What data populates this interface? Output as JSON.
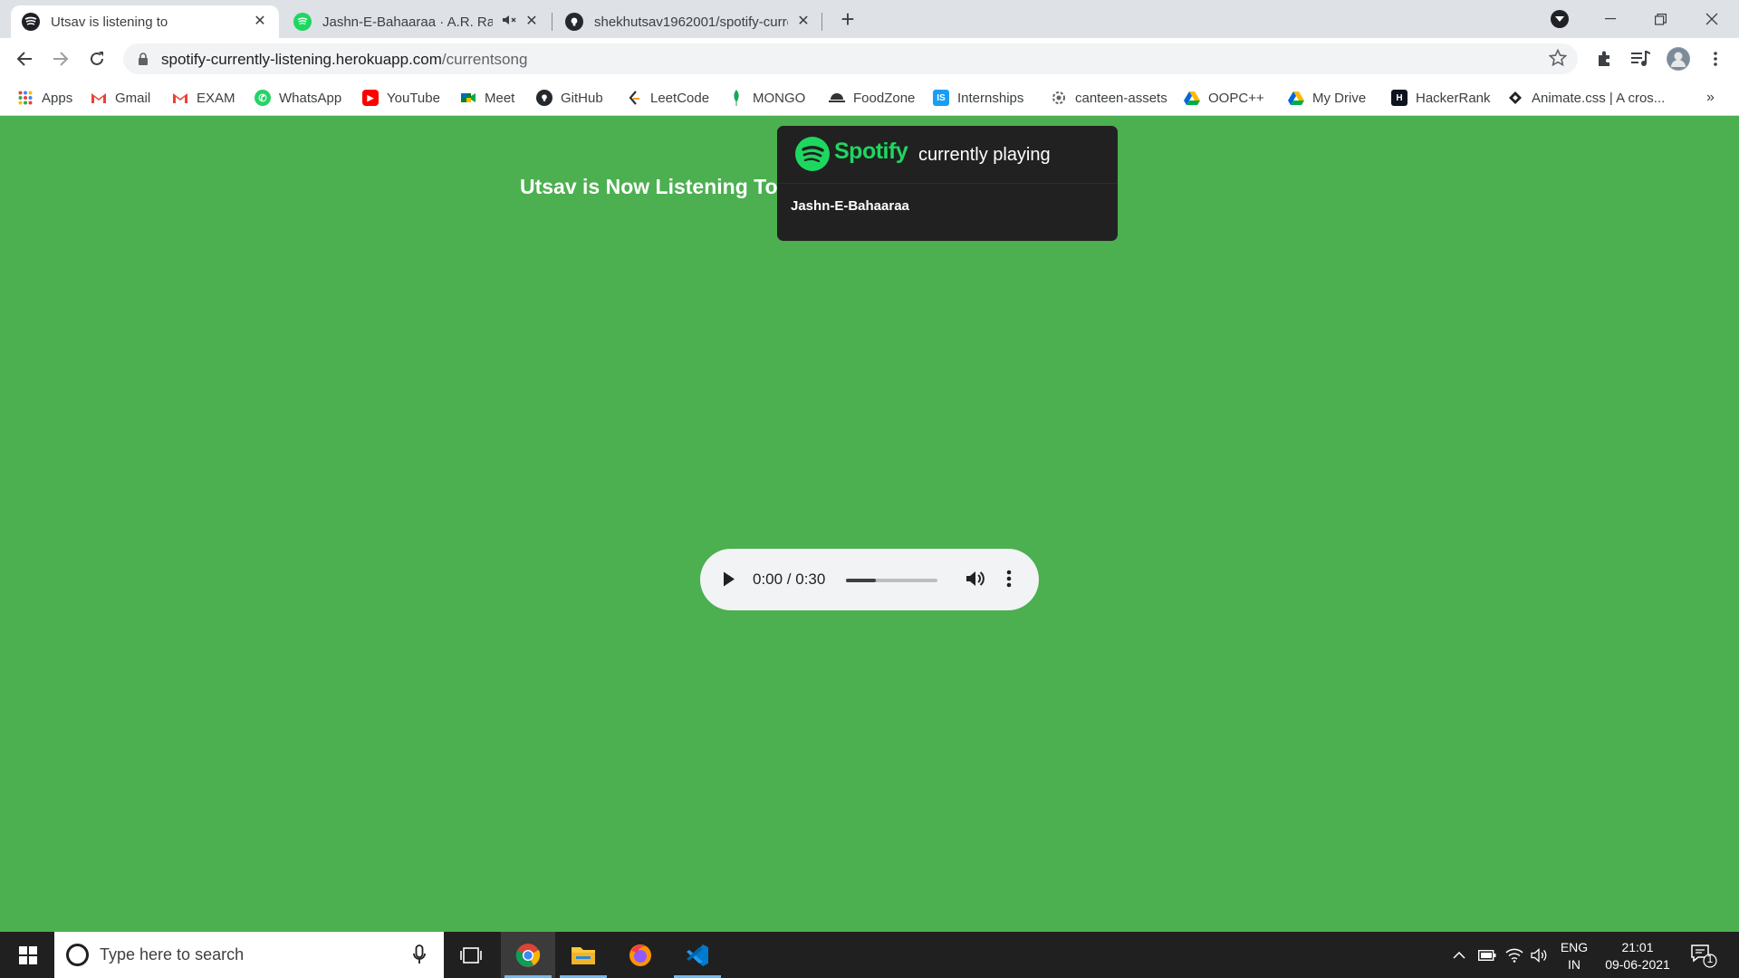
{
  "browser": {
    "tabs": [
      {
        "title": "Utsav is listening to",
        "active": true
      },
      {
        "title": "Jashn-E-Bahaaraa · A.R. Rahman",
        "active": false
      },
      {
        "title": "shekhutsav1962001/spotify-currently-listening",
        "active": false
      }
    ],
    "url_domain": "spotify-currently-listening.herokuapp.com",
    "url_path": "/currentsong",
    "bookmarks": [
      "Apps",
      "Gmail",
      "EXAM",
      "WhatsApp",
      "YouTube",
      "Meet",
      "GitHub",
      "LeetCode",
      "MONGO",
      "FoodZone",
      "Internships",
      "canteen-assets",
      "OOPC++",
      "My Drive",
      "HackerRank",
      "Animate.css | A cros..."
    ]
  },
  "page": {
    "heading": "Utsav is Now Listening To",
    "card": {
      "brand": "Spotify",
      "subtitle": "currently playing",
      "song": "Jashn-E-Bahaaraa"
    },
    "player": {
      "time": "0:00 / 0:30",
      "volume_level": 0.33
    }
  },
  "taskbar": {
    "search_placeholder": "Type here to search",
    "lang_line1": "ENG",
    "lang_line2": "IN",
    "time": "21:01",
    "date": "09-06-2021",
    "notification_count": "1"
  },
  "colors": {
    "page_bg": "#4caf50",
    "card_bg": "#212121",
    "spotify_green": "#1ed760"
  }
}
